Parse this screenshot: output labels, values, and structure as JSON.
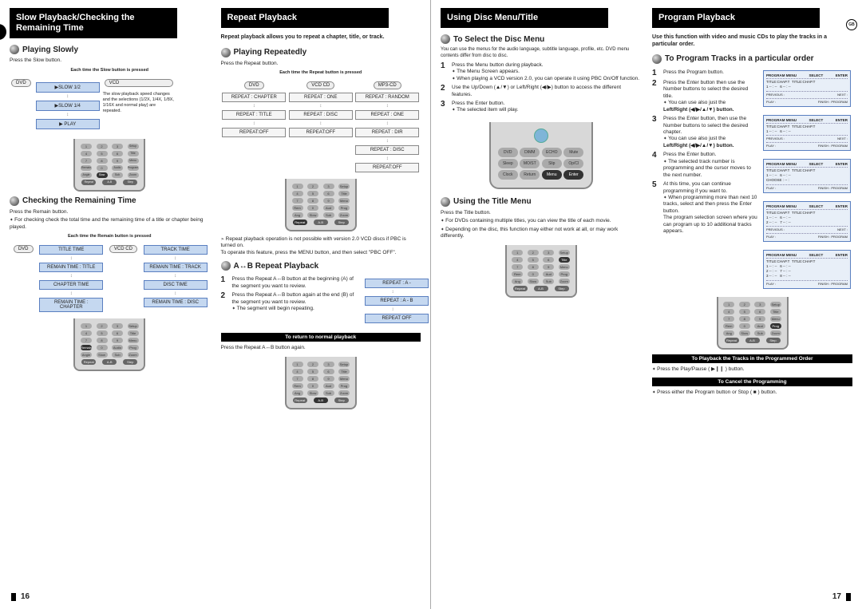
{
  "pageLeft": {
    "num": "16",
    "colA": {
      "title": "Slow Playback/Checking the Remaining Time",
      "h1": "Playing Slowly",
      "p1": "Press the Slow button.",
      "tiny1": "Each time the Slow button is pressed",
      "flow": [
        "▶SLOW 1/2",
        "▶SLOW 1/4",
        "▶ PLAY"
      ],
      "flowNote": "The slow playback speed changes and the selections (1/2X, 1/4X, 1/8X, 1/16X and normal play) are repeated.",
      "discs": [
        "DVD",
        "VCD"
      ],
      "h2": "Checking the Remaining Time",
      "p2": "Press the Remain button.",
      "p2b": "For checking check the total time and the remaining time of a title or chapter being played.",
      "tiny2": "Each time the Remain button is pressed",
      "groupA_label": "DVD",
      "groupA": [
        "TITLE TIME",
        "REMAIN TIME : TITLE",
        "CHAPTER TIME",
        "REMAIN TIME : CHAPTER"
      ],
      "groupB_label": "VCD CD",
      "groupB": [
        "TRACK TIME",
        "REMAIN TIME : TRACK",
        "DISC TIME",
        "REMAIN TIME : DISC"
      ]
    },
    "colB": {
      "title": "Repeat Playback",
      "intro": "Repeat playback allows you to repeat a chapter, title, or track.",
      "h1": "Playing Repeatedly",
      "p1": "Press the Repeat button.",
      "tiny1": "Each time the Repeat button is pressed",
      "grp1_lbl": "DVD",
      "grp1": [
        "REPEAT : CHAPTER",
        "REPEAT : TITLE",
        "REPEAT:OFF"
      ],
      "grp2_lbl": "VCD CD",
      "grp2": [
        "REPEAT : ONE",
        "REPEAT : DISC",
        "REPEAT:OFF"
      ],
      "grp3_lbl": "MP3-CD",
      "grp3": [
        "REPEAT : RANDOM",
        "REPEAT : ONE",
        "REPEAT : DIR",
        "REPEAT : DISC",
        "REPEAT:OFF"
      ],
      "note1": "Repeat playback operation is not possible with version 2.0 VCD discs if PBC is turned on.\nTo operate this feature, press the MENU button, and then select \"PBC OFF\".",
      "h2": "A↔B Repeat Playback",
      "step1": "Press the Repeat A↔B button at the beginning (A) of the segment you want to review.",
      "step2": "Press the Repeat A↔B button again at the end (B) of the segment you want to review.",
      "step2b": "The segment will begin repeating.",
      "abflow": [
        "REPEAT : A -",
        "REPEAT : A - B",
        "REPEAT OFF"
      ],
      "strip1": "To return to normal playback",
      "strip1txt": "Press the Repeat A↔B button again."
    }
  },
  "pageRight": {
    "num": "17",
    "gb": "GB",
    "colA": {
      "title": "Using Disc Menu/Title",
      "h1": "To Select the Disc Menu",
      "h1sub": "You can use the menus for the audio language, subtitle language, profile, etc. DVD menu contents differ from disc to disc.",
      "s1": "Press the Menu button during playback.",
      "s1a": "The Menu Screen appears.",
      "s1b": "When playing a VCD version 2.0, you can operate it using PBC On/Off function.",
      "s2": "Use the Up/Down (▲/▼) or Left/Right (◀/▶) button to access the different features.",
      "s3": "Press the Enter button.",
      "s3a": "The selected item will play.",
      "h2": "Using the Title Menu",
      "p2": "Press the Title button.",
      "p2a": "For DVDs containing multiple titles, you can view the title of each movie.",
      "p2b": "Depending on the disc, this function may either not work at all, or may work differently."
    },
    "colB": {
      "title": "Program Playback",
      "intro": "Use this function with video and music CDs to play the tracks in a particular order.",
      "h1": "To Program Tracks in a particular order",
      "s1": "Press the Program button.",
      "s2": "Press the Enter button then use the Number buttons to select the desired title.",
      "s2a": "You can use  also just the",
      "s2b": "Left/Right (◀/▶/▲/▼) button.",
      "s3": "Press the Enter button, then use the Number buttons to select the desired chapter.",
      "s3a": "You can use  also just the",
      "s3b": "Left/Right (◀/▶/▲/▼) button.",
      "s4": "Press the Enter button.",
      "s4a": "The selected track number is programming and the cursor moves to the next number.",
      "s5": "At this time, you can continue programming if you want to.",
      "s5a": "When programming more than next 10 tracks, select and then press the Enter button.\nThe program selection screen where you can program up to 10 additional tracks appears.",
      "strip1": "To Playback the Tracks in the Programmed Order",
      "strip1txt": "Press the Play/Pause ( ▶❙❙ ) button.",
      "strip2": "To Cancel the Programming",
      "strip2txt": "Press either the Program button or Stop ( ■ ) button.",
      "osd_head1": "PROGRAM MENU",
      "osd_head2": "SELECT",
      "osd_head3": "ENTER",
      "osd_line1": "TITLE:CHAP.T",
      "osd_line2": "TITLE:CHAP.T",
      "osd_prev": "PREVIOUS :",
      "osd_next": "NEXT :",
      "osd_play": "PLAY :",
      "osd_fin": "FINISH : PROGRAM",
      "osd_choose": "CHOOSE : -- :"
    }
  }
}
